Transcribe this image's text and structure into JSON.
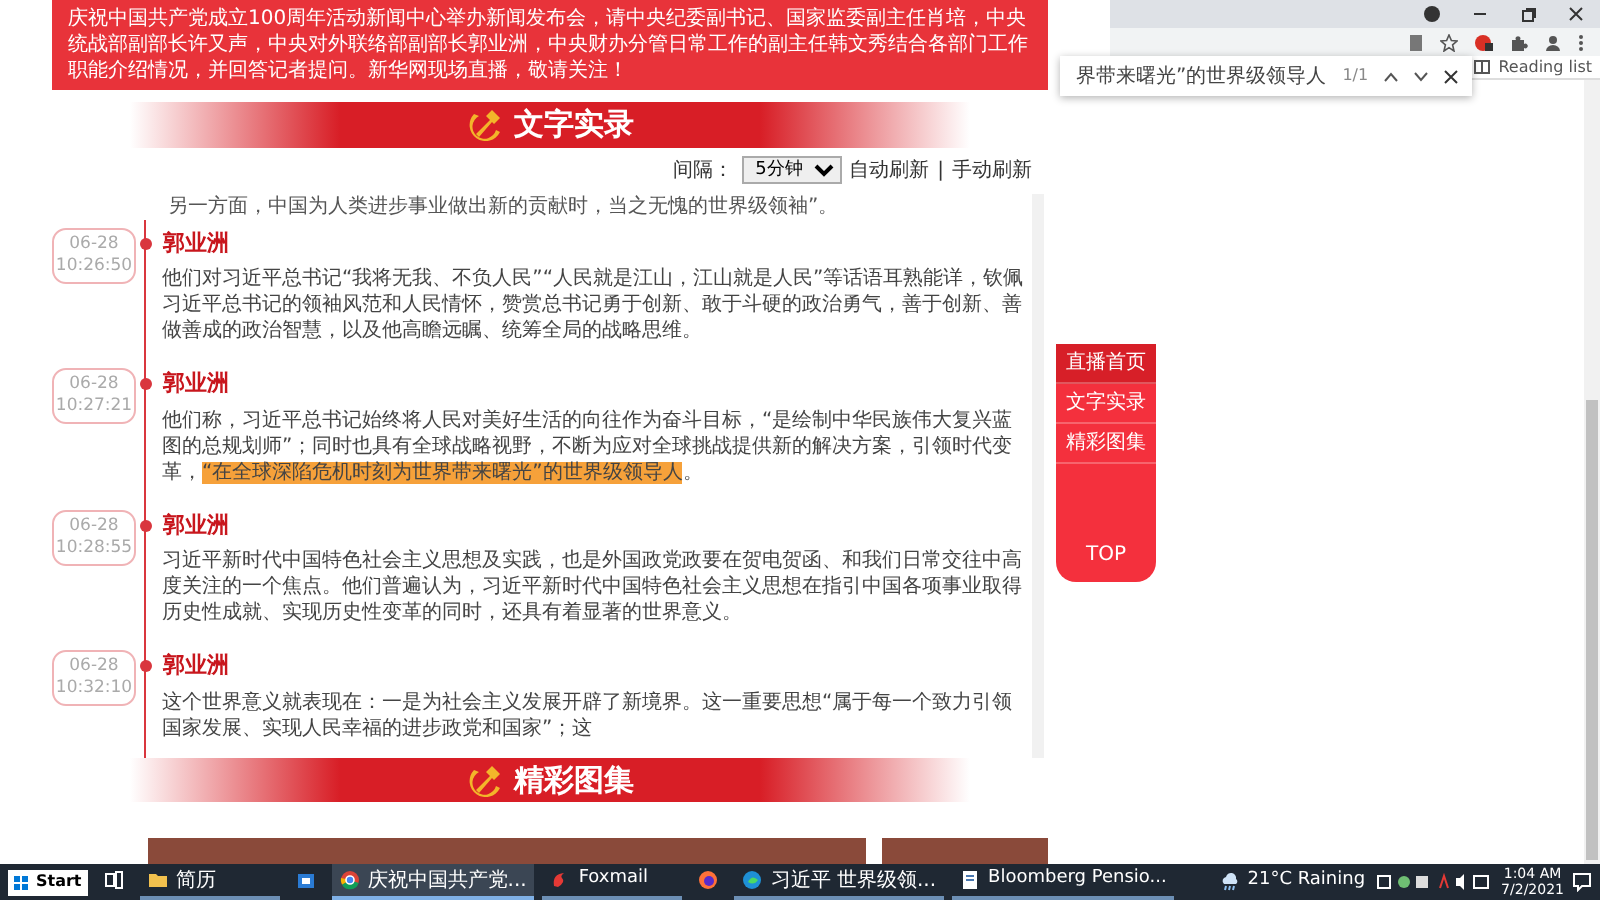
{
  "banner": {
    "text": "庆祝中国共产党成立100周年活动新闻中心举办新闻发布会，请中央纪委副书记、国家监委副主任肖培，中央统战部副部长许又声，中央对外联络部副部长郭业洲，中央财办分管日常工作的副主任韩文秀结合各部门工作职能介绍情况，并回答记者提问。新华网现场直播，敬请关注！"
  },
  "live_section": {
    "title": "文字实录"
  },
  "refresh_controls": {
    "label": "间隔：",
    "interval": "5分钟",
    "auto": "自动刷新",
    "separator": "|",
    "manual": "手动刷新"
  },
  "partial_line": "另一方面，中国为人类进步事业做出新的贡献时，当之无愧的世界级领袖”。",
  "entries": [
    {
      "date": "06-28",
      "time": "10:26:50",
      "speaker": "郭业洲",
      "segments": [
        {
          "text": "他们对习近平总书记“我将无我、不负人民”“人民就是江山，江山就是人民”等话语耳熟能详，钦佩习近平总书记的领袖风范和人民情怀，赞赏总书记勇于创新、敢于斗硬的政治勇气，善于创新、善做善成的政治智慧，以及他高瞻远瞩、统筹全局的战略思维。",
          "highlighted": false
        }
      ]
    },
    {
      "date": "06-28",
      "time": "10:27:21",
      "speaker": "郭业洲",
      "segments": [
        {
          "text": "他们称，习近平总书记始终将人民对美好生活的向往作为奋斗目标，“是绘制中华民族伟大复兴蓝图的总规划师”；同时也具有全球战略视野，不断为应对全球挑战提供新的解决方案，引领时代变革，",
          "highlighted": false
        },
        {
          "text": "“在全球深陷危机时刻为世界带来曙光”的世界级领导人",
          "highlighted": true
        },
        {
          "text": "。",
          "highlighted": false
        }
      ]
    },
    {
      "date": "06-28",
      "time": "10:28:55",
      "speaker": "郭业洲",
      "segments": [
        {
          "text": "习近平新时代中国特色社会主义思想及实践，也是外国政党政要在贺电贺函、和我们日常交往中高度关注的一个焦点。他们普遍认为，习近平新时代中国特色社会主义思想在指引中国各项事业取得历史性成就、实现历史性变革的同时，还具有着显著的世界意义。",
          "highlighted": false
        }
      ]
    },
    {
      "date": "06-28",
      "time": "10:32:10",
      "speaker": "郭业洲",
      "segments": [
        {
          "text": "这个世界意义就表现在：一是为社会主义发展开辟了新境界。这一重要思想“属于每一个致力引领国家发展、实现人民幸福的进步政党和国家”；这",
          "highlighted": false
        }
      ]
    }
  ],
  "gallery_section": {
    "title": "精彩图集"
  },
  "side_nav": {
    "items": [
      {
        "label": "直播首页",
        "selected": true
      },
      {
        "label": "文字实录",
        "selected": false
      },
      {
        "label": "精彩图集",
        "selected": false
      }
    ],
    "top": "TOP"
  },
  "find_bar": {
    "query": "界带来曙光”的世界级领导人",
    "count": "1/1"
  },
  "reading_list": "Reading list",
  "taskbar": {
    "start": "Start",
    "apps": [
      {
        "kind": "taskview",
        "selected": false
      },
      {
        "kind": "folder",
        "label": "简历",
        "selected": false
      },
      {
        "kind": "store",
        "selected": false
      },
      {
        "kind": "chrome",
        "label": "庆祝中国共产党...",
        "selected": true
      },
      {
        "kind": "foxmail",
        "label": "Foxmail",
        "selected": false
      },
      {
        "kind": "firefox",
        "selected": false
      },
      {
        "kind": "edge",
        "label": "习近平 世界级领...",
        "selected": false
      },
      {
        "kind": "document",
        "label": "Bloomberg Pensio...",
        "selected": false
      }
    ],
    "weather": "21°C Raining",
    "time": "1:04 AM",
    "date": "7/2/2021"
  }
}
